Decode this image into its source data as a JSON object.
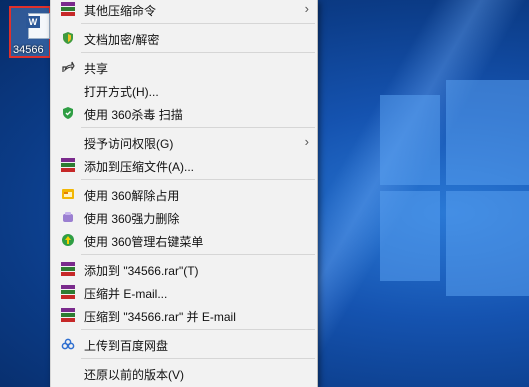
{
  "desktop": {
    "file": {
      "name": "34566",
      "icon": "word-document-icon"
    }
  },
  "menu": {
    "items": [
      {
        "label": "其他压缩命令",
        "icon": "winrar-icon",
        "submenu": true
      },
      {
        "label": "文档加密/解密",
        "icon": "shield-icon",
        "submenu": false
      },
      {
        "label": "共享",
        "icon": "share-icon",
        "submenu": false
      },
      {
        "label": "打开方式(H)...",
        "icon": "",
        "submenu": false
      },
      {
        "label": "使用 360杀毒 扫描",
        "icon": "360-shield-icon",
        "submenu": false
      },
      {
        "label": "授予访问权限(G)",
        "icon": "",
        "submenu": true
      },
      {
        "label": "添加到压缩文件(A)...",
        "icon": "winrar-icon",
        "submenu": false
      },
      {
        "label": "使用 360解除占用",
        "icon": "unlock-icon",
        "submenu": false
      },
      {
        "label": "使用 360强力删除",
        "icon": "eraser-icon",
        "submenu": false
      },
      {
        "label": "使用 360管理右键菜单",
        "icon": "360-manager-icon",
        "submenu": false
      },
      {
        "label": "添加到 \"34566.rar\"(T)",
        "icon": "winrar-icon",
        "submenu": false
      },
      {
        "label": "压缩并 E-mail...",
        "icon": "winrar-icon",
        "submenu": false
      },
      {
        "label": "压缩到 \"34566.rar\" 并 E-mail",
        "icon": "winrar-icon",
        "submenu": false
      },
      {
        "label": "上传到百度网盘",
        "icon": "baidu-cloud-icon",
        "submenu": false
      },
      {
        "label": "还原以前的版本(V)",
        "icon": "",
        "submenu": false
      }
    ]
  },
  "colors": {
    "menu_bg": "#f2f2f2",
    "highlight": "#e0302b",
    "desktop": "#0b3b86"
  }
}
